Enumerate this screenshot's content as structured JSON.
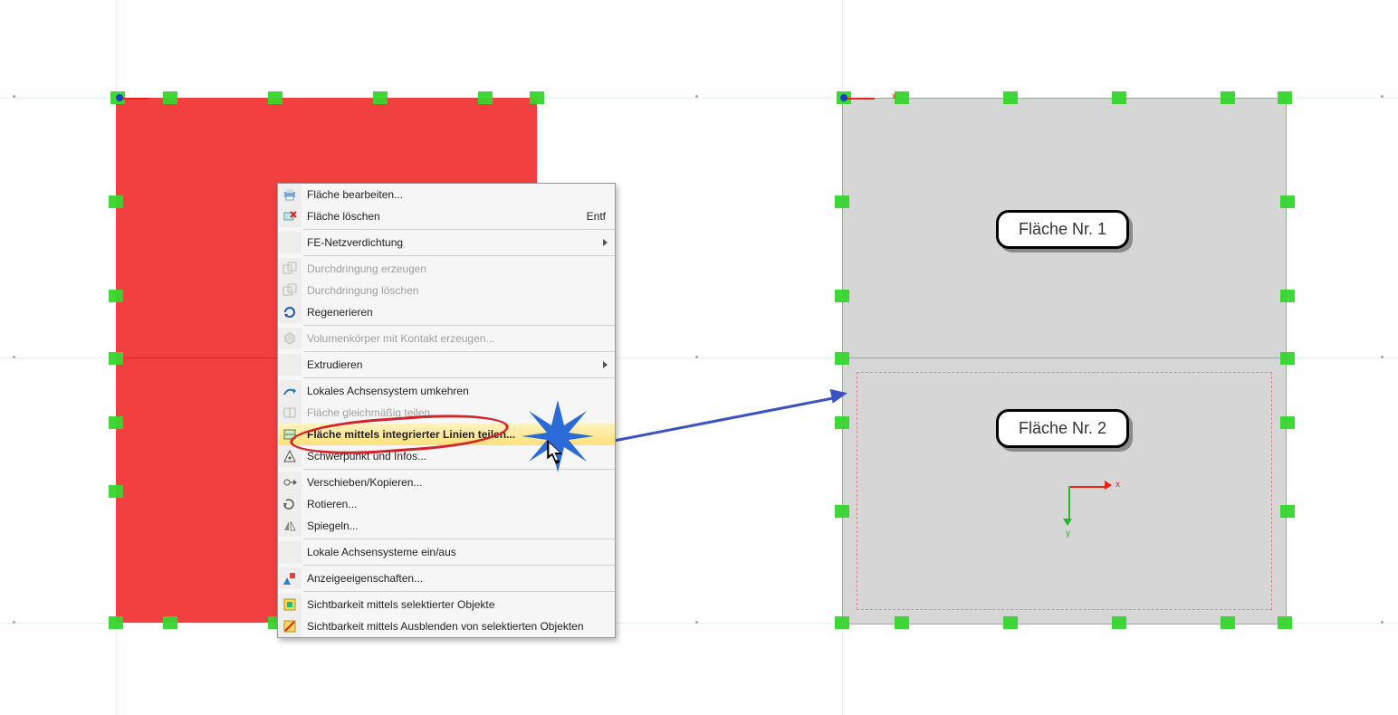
{
  "menu": {
    "edit_surface": "Fläche bearbeiten...",
    "delete_surface": "Fläche löschen",
    "delete_shortcut": "Entf",
    "fe_mesh": "FE-Netzverdichtung",
    "intersection_create": "Durchdringung erzeugen",
    "intersection_delete": "Durchdringung löschen",
    "regenerate": "Regenerieren",
    "solid_contact": "Volumenkörper mit Kontakt erzeugen...",
    "extrude": "Extrudieren",
    "reverse_axis": "Lokales Achsensystem umkehren",
    "split_even": "Fläche gleichmäßig teilen...",
    "split_lines": "Fläche mittels integrierter Linien teilen...",
    "centroid": "Schwerpunkt und Infos...",
    "move_copy": "Verschieben/Kopieren...",
    "rotate": "Rotieren...",
    "mirror": "Spiegeln...",
    "local_axes_toggle": "Lokale Achsensysteme ein/aus",
    "display_props": "Anzeigeeigenschaften...",
    "vis_selected": "Sichtbarkeit mittels selektierter Objekte",
    "vis_hide_selected": "Sichtbarkeit mittels Ausblenden von selektierten Objekten"
  },
  "labels": {
    "surface1": "Fläche Nr. 1",
    "surface2": "Fläche Nr. 2",
    "axis_x": "x",
    "axis_y": "y"
  }
}
